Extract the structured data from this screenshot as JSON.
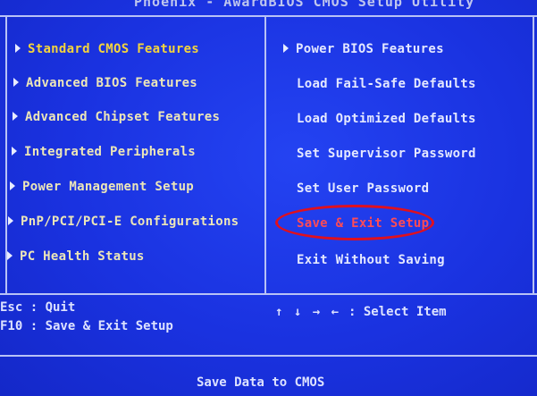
{
  "title": "Phoenix - AwardBIOS CMOS Setup Utility",
  "left_menu": [
    {
      "label": "Standard CMOS Features"
    },
    {
      "label": "Advanced BIOS Features"
    },
    {
      "label": "Advanced Chipset Features"
    },
    {
      "label": "Integrated Peripherals"
    },
    {
      "label": "Power Management Setup"
    },
    {
      "label": "PnP/PCI/PCI-E Configurations"
    },
    {
      "label": "PC Health Status"
    }
  ],
  "right_menu": [
    {
      "label": "Power BIOS Features"
    },
    {
      "label": "Load Fail-Safe Defaults"
    },
    {
      "label": "Load Optimized Defaults"
    },
    {
      "label": "Set Supervisor Password"
    },
    {
      "label": "Set User Password"
    },
    {
      "label": "Save & Exit Setup"
    },
    {
      "label": "Exit Without Saving"
    }
  ],
  "help": {
    "esc": "Esc : Quit",
    "f10": "F10 : Save & Exit Setup",
    "arrows": "↑ ↓ → ←",
    "select": ": Select Item"
  },
  "status": "Save Data to CMOS",
  "colors": {
    "background": "#1b2fe0",
    "menu_text": "#f2d23a",
    "highlight_ring": "#e0101e"
  }
}
